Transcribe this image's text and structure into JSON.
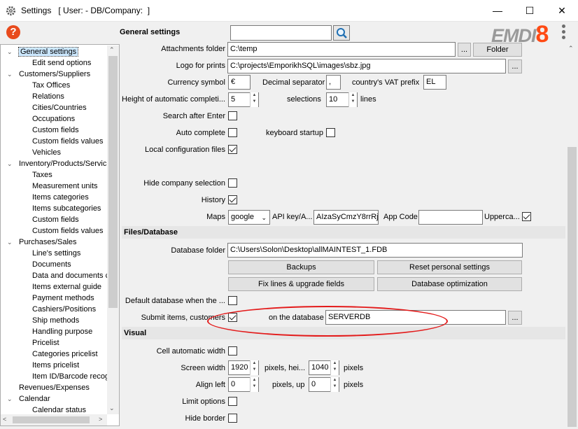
{
  "window": {
    "title": "Settings   [ User: - DB/Company:  ]",
    "minimize_glyph": "—",
    "maximize_glyph": "☐",
    "close_glyph": "✕"
  },
  "header": {
    "help_glyph": "?",
    "title": "General settings",
    "search_value": "",
    "logo_text": "EMDI",
    "logo_num": "8"
  },
  "tree": {
    "items": [
      {
        "label": "General settings",
        "toggle": "⌄"
      },
      {
        "label": "Edit send options",
        "toggle": ""
      },
      {
        "label": "Customers/Suppliers",
        "toggle": "⌄"
      },
      {
        "label": "Tax Offices",
        "toggle": ""
      },
      {
        "label": "Relations",
        "toggle": ""
      },
      {
        "label": "Cities/Countries",
        "toggle": ""
      },
      {
        "label": "Occupations",
        "toggle": ""
      },
      {
        "label": "Custom fields",
        "toggle": ""
      },
      {
        "label": "Custom fields values",
        "toggle": ""
      },
      {
        "label": "Vehicles",
        "toggle": ""
      },
      {
        "label": "Inventory/Products/Servic",
        "toggle": "⌄"
      },
      {
        "label": "Taxes",
        "toggle": ""
      },
      {
        "label": "Measurement units",
        "toggle": ""
      },
      {
        "label": "Items categories",
        "toggle": ""
      },
      {
        "label": "Items subcategories",
        "toggle": ""
      },
      {
        "label": "Custom fields",
        "toggle": ""
      },
      {
        "label": "Custom fields values",
        "toggle": ""
      },
      {
        "label": "Purchases/Sales",
        "toggle": "⌄"
      },
      {
        "label": "Line's settings",
        "toggle": ""
      },
      {
        "label": "Documents",
        "toggle": ""
      },
      {
        "label": "Data and documents c",
        "toggle": ""
      },
      {
        "label": "Items external guide",
        "toggle": ""
      },
      {
        "label": "Payment methods",
        "toggle": ""
      },
      {
        "label": "Cashiers/Positions",
        "toggle": ""
      },
      {
        "label": "Ship methods",
        "toggle": ""
      },
      {
        "label": "Handling purpose",
        "toggle": ""
      },
      {
        "label": "Pricelist",
        "toggle": ""
      },
      {
        "label": "Categories pricelist",
        "toggle": ""
      },
      {
        "label": "Items pricelist",
        "toggle": ""
      },
      {
        "label": "Item ID/Barcode recog",
        "toggle": ""
      },
      {
        "label": "Revenues/Expenses",
        "toggle": ""
      },
      {
        "label": "Calendar",
        "toggle": "⌄"
      },
      {
        "label": "Calendar status",
        "toggle": ""
      }
    ]
  },
  "settings": {
    "attachments_label": "Attachments folder",
    "attachments_value": "C:\\temp",
    "attachments_browse": "...",
    "folder_button": "Folder",
    "logo_label": "Logo for prints",
    "logo_value": "C:\\projects\\EmporikhSQL\\images\\sbz.jpg",
    "logo_browse": "...",
    "currency_label": "Currency symbol",
    "currency_value": "€",
    "decimal_label": "Decimal separator",
    "decimal_value": ",",
    "vat_label": "country's VAT prefix",
    "vat_value": "EL",
    "height_label": "Height of automatic completi...",
    "height_value": "5",
    "selections_label": "selections",
    "selections_value": "10",
    "lines_label": "lines",
    "search_after_enter_label": "Search after Enter",
    "auto_complete_label": "Auto complete",
    "keyboard_startup_label": "keyboard startup",
    "local_config_label": "Local configuration files",
    "hide_company_label": "Hide company selection",
    "history_label": "History",
    "maps_label": "Maps",
    "maps_value": "google",
    "api_key_label": "API key/A...",
    "api_key_value": "AIzaSyCmzY8rrRj",
    "app_code_label": "App Code",
    "app_code_value": "",
    "upperca_label": "Upperca..."
  },
  "files_database": {
    "section_title": "Files/Database",
    "db_folder_label": "Database folder",
    "db_folder_value": "C:\\Users\\Solon\\Desktop\\allMAINTEST_1.FDB",
    "backups_button": "Backups",
    "reset_button": "Reset personal settings",
    "fix_lines_button": "Fix lines & upgrade fields",
    "db_optimization_button": "Database optimization",
    "default_db_label": "Default database when the ...",
    "submit_items_label": "Submit items, customers",
    "on_database_label": "on the database",
    "on_database_value": "SERVERDB",
    "on_database_browse": "..."
  },
  "visual": {
    "section_title": "Visual",
    "cell_auto_width_label": "Cell automatic width",
    "screen_width_label": "Screen width",
    "screen_width_value": "1920",
    "pixels_height_label": "pixels, hei...",
    "screen_height_value": "1040",
    "pixels_label": "pixels",
    "align_left_label": "Align left",
    "align_left_value": "0",
    "pixels_up_label": "pixels, up",
    "align_up_value": "0",
    "pixels_label_2": "pixels",
    "limit_options_label": "Limit options",
    "hide_border_label": "Hide border"
  },
  "checkbox_states": {
    "search_after_enter": false,
    "auto_complete": false,
    "keyboard_startup": false,
    "local_config": true,
    "hide_company": false,
    "history": true,
    "upperca": true,
    "default_db": false,
    "submit_items": true,
    "cell_auto_width": false,
    "limit_options": false,
    "hide_border": false
  },
  "colors": {
    "accent_orange": "#ff4a14",
    "annotation_red": "#e31b1b",
    "selection_blue": "#cce8ff"
  }
}
